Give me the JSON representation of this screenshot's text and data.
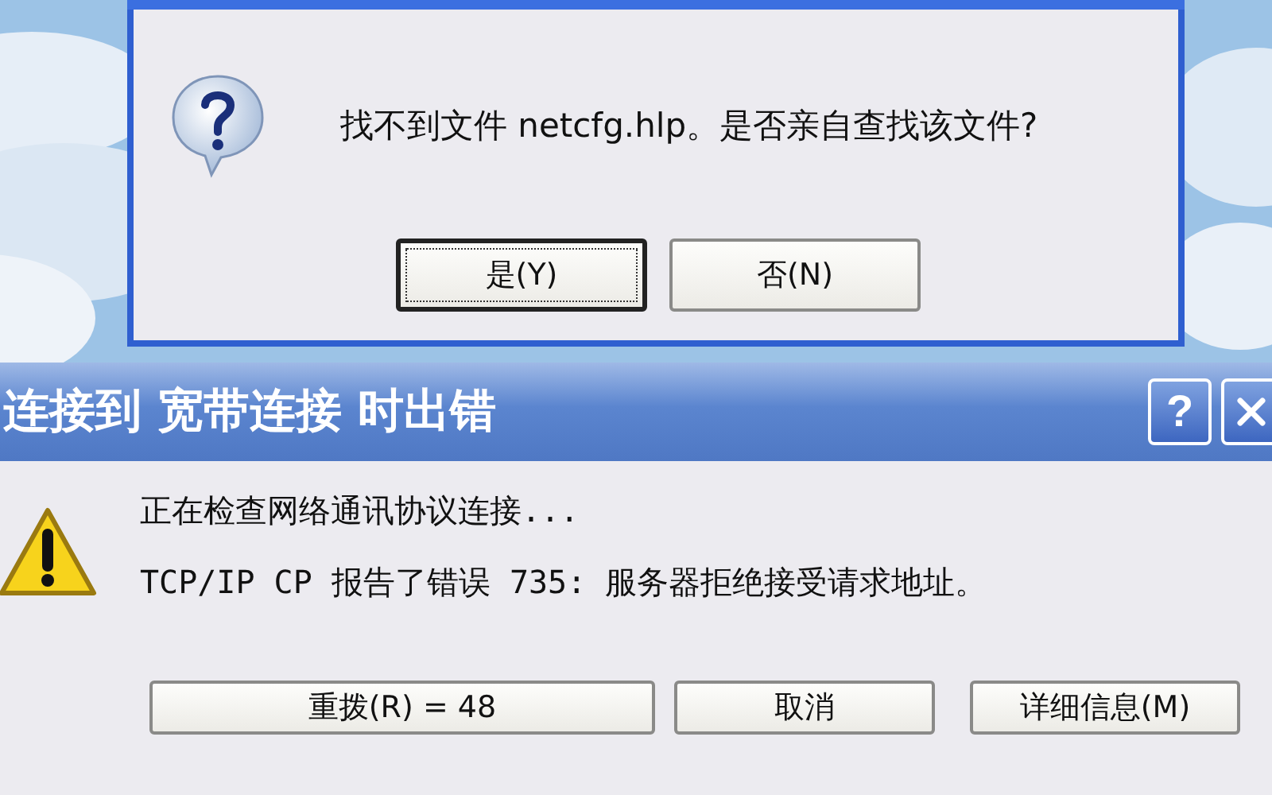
{
  "question_dialog": {
    "message": "找不到文件 netcfg.hlp。是否亲自查找该文件?",
    "buttons": [
      {
        "label": "是(Y)",
        "focused": true
      },
      {
        "label": "否(N)",
        "focused": false
      }
    ]
  },
  "error_dialog": {
    "title": "连接到 宽带连接 时出错",
    "help_button": "?",
    "messages": [
      "正在检查网络通讯协议连接...",
      "TCP/IP CP 报告了错误 735: 服务器拒绝接受请求地址。"
    ],
    "buttons": [
      "重拨(R) = 48",
      "取消",
      "详细信息(M)"
    ]
  }
}
